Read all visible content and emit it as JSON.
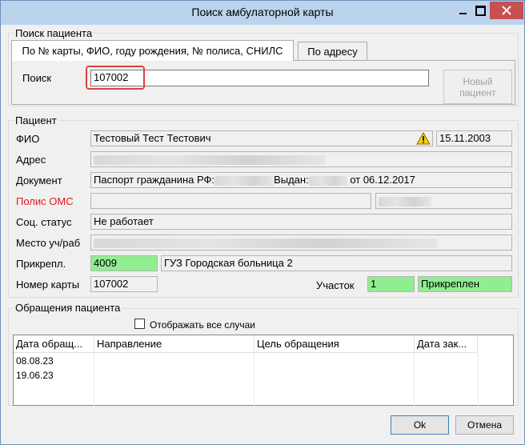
{
  "window": {
    "title": "Поиск амбулаторной карты"
  },
  "search_group": {
    "legend": "Поиск пациента",
    "tabs": [
      {
        "label": "По № карты, ФИО, году рождения, № полиса, СНИЛС",
        "active": true
      },
      {
        "label": "По адресу",
        "active": false
      }
    ],
    "search_label": "Поиск",
    "search_value": "107002",
    "new_patient_button": "Новый пациент"
  },
  "patient": {
    "legend": "Пациент",
    "fio_label": "ФИО",
    "fio_value": "Тестовый Тест Тестович",
    "birth_date": "15.11.2003",
    "address_label": "Адрес",
    "document_label": "Документ",
    "document_prefix": "Паспорт гражданина РФ:",
    "document_issued": "Выдан:",
    "document_date": "от 06.12.2017",
    "oms_label": "Полис ОМС",
    "oms_label_color": "#e8141a",
    "social_label": "Соц. статус",
    "social_value": "Не работает",
    "workplace_label": "Место уч/раб",
    "attach_label": "Прикрепл.",
    "attach_code": "4009",
    "attach_org": "ГУЗ Городская больница 2",
    "card_label": "Номер карты",
    "card_value": "107002",
    "district_label": "Участок",
    "district_value": "1",
    "attach_status": "Прикреплен",
    "green_color": "#90ee90"
  },
  "visits": {
    "legend": "Обращения пациента",
    "show_all_label": "Отображать все случаи",
    "show_all_checked": false,
    "columns": [
      "Дата обращ...",
      "Направление",
      "Цель обращения",
      "Дата зак..."
    ],
    "rows": [
      [
        "08.08.23",
        "",
        "",
        ""
      ],
      [
        "19.06.23",
        "",
        "",
        ""
      ]
    ]
  },
  "footer": {
    "ok": "Ok",
    "cancel": "Отмена"
  }
}
